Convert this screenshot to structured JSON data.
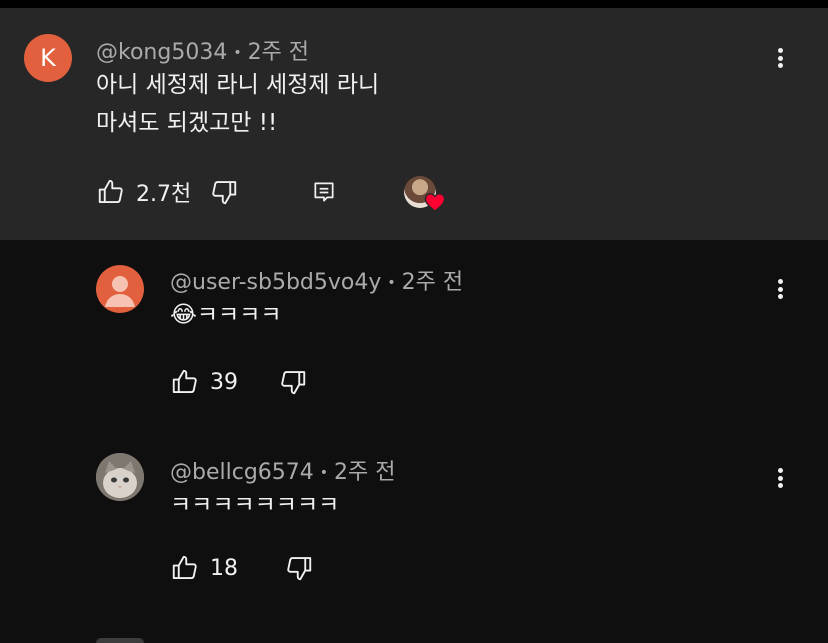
{
  "parent_comment": {
    "avatar_letter": "K",
    "author": "@kong5034",
    "time": "2주 전",
    "lines": [
      "아니 세정제 라니 세정제 라니",
      "마셔도 되겠고만 !!"
    ],
    "likes": "2.7천",
    "creator_heart": true
  },
  "replies": [
    {
      "author": "@user-sb5bd5vo4y",
      "time": "2주 전",
      "emoji": "😂",
      "text": "ㅋㅋㅋㅋ",
      "likes": "39"
    },
    {
      "author": "@bellcg6574",
      "time": "2주 전",
      "text": "ㅋㅋㅋㅋㅋㅋㅋㅋ",
      "likes": "18"
    }
  ],
  "colors": {
    "background": "#0f0f0f",
    "highlighted": "#272727",
    "avatar_orange": "#e2603d",
    "heart_red": "#ff0033",
    "meta_text": "#aaaaaa"
  },
  "icons": [
    "like-icon",
    "dislike-icon",
    "reply-icon",
    "more-vert-icon",
    "creator-heart-icon"
  ]
}
